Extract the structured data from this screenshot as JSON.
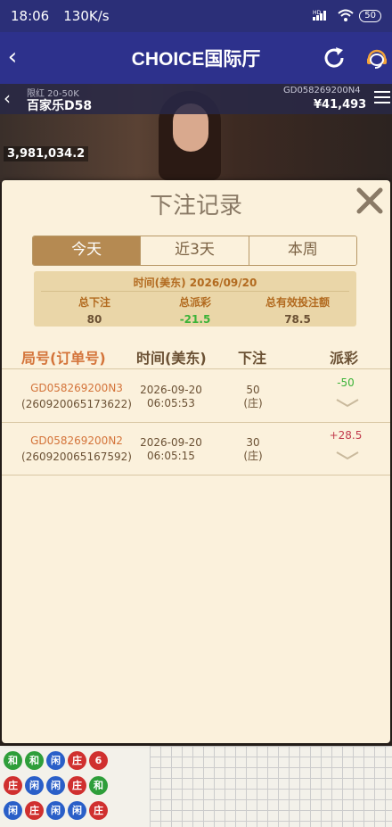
{
  "status_bar": {
    "time": "18:06",
    "speed": "130K/s",
    "battery": "50",
    "signal_label": "HD"
  },
  "header": {
    "title": "CHOICE国际厅"
  },
  "table": {
    "limit": "限红 20-50K",
    "name": "百家乐D58",
    "game_id": "GD058269200N4",
    "balance": "¥41,493",
    "player_balance": "3,981,034.2"
  },
  "modal": {
    "title": "下注记录",
    "tabs": [
      {
        "label": "今天",
        "active": true
      },
      {
        "label": "近3天",
        "active": false
      },
      {
        "label": "本周",
        "active": false
      }
    ],
    "summary": {
      "date_label": "时间(美东)  2026/09/20",
      "total_bet_label": "总下注",
      "total_bet": "80",
      "total_payout_label": "总派彩",
      "total_payout": "-21.5",
      "valid_bet_label": "总有效投注额",
      "valid_bet": "78.5"
    },
    "columns": [
      "局号(订单号)",
      "时间(美东)",
      "下注",
      "派彩"
    ],
    "rows": [
      {
        "game_no": "GD058269200N3",
        "order_no": "(260920065173622)",
        "date": "2026-09-20",
        "time": "06:05:53",
        "bet": "50",
        "bet_side": "(庄)",
        "payout": "-50"
      },
      {
        "game_no": "GD058269200N2",
        "order_no": "(260920065167592)",
        "date": "2026-09-20",
        "time": "06:05:15",
        "bet": "30",
        "bet_side": "(庄)",
        "payout": "+28.5"
      }
    ]
  },
  "colors": {
    "header_bg": "#2d318c",
    "modal_bg": "#fbf1dc",
    "tab_active": "#b58a52",
    "accent_orange": "#d4743a",
    "positive": "#c23b4d",
    "negative": "#3bb338"
  },
  "road_beads": [
    {
      "label": "和",
      "color": "#2e9e3a"
    },
    {
      "label": "和",
      "color": "#2e9e3a"
    },
    {
      "label": "闲",
      "color": "#2a5fc8"
    },
    {
      "label": "庄",
      "color": "#d0302f"
    },
    {
      "label": "6",
      "color": "#d0302f"
    },
    {
      "label": "庄",
      "color": "#d0302f"
    },
    {
      "label": "闲",
      "color": "#2a5fc8"
    },
    {
      "label": "闲",
      "color": "#2a5fc8"
    },
    {
      "label": "庄",
      "color": "#d0302f"
    },
    {
      "label": "和",
      "color": "#2e9e3a"
    },
    {
      "label": "闲",
      "color": "#2a5fc8"
    },
    {
      "label": "庄",
      "color": "#d0302f"
    },
    {
      "label": "闲",
      "color": "#2a5fc8"
    },
    {
      "label": "闲",
      "color": "#2a5fc8"
    },
    {
      "label": "庄",
      "color": "#d0302f"
    }
  ]
}
